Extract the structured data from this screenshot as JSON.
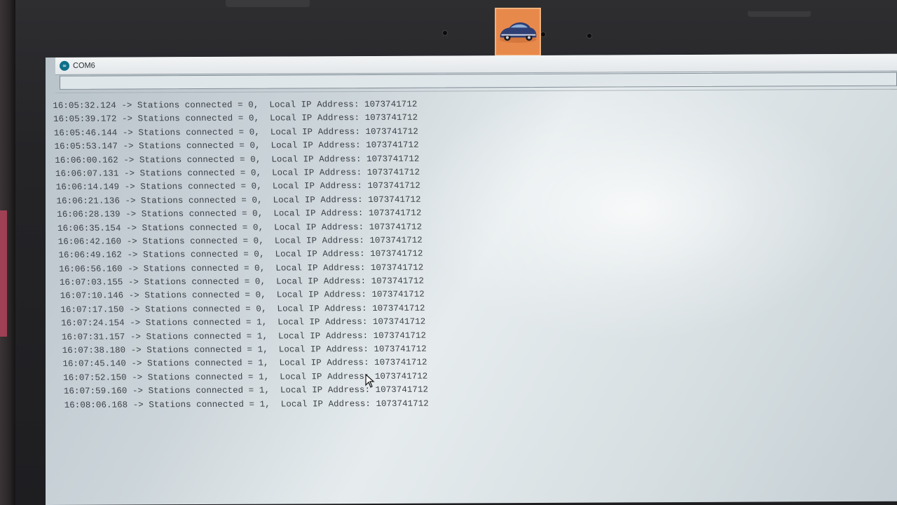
{
  "window": {
    "title": "COM6",
    "app_icon": "arduino-icon",
    "send_field_value": ""
  },
  "serial_output": [
    {
      "time": "16:05:32.124",
      "arrow": "->",
      "label": "Stations connected",
      "eq": "=",
      "count": "0,",
      "ip_label": "Local IP Address:",
      "ip": "1073741712"
    },
    {
      "time": "16:05:39.172",
      "arrow": "->",
      "label": "Stations connected",
      "eq": "=",
      "count": "0,",
      "ip_label": "Local IP Address:",
      "ip": "1073741712"
    },
    {
      "time": "16:05:46.144",
      "arrow": "->",
      "label": "Stations connected",
      "eq": "=",
      "count": "0,",
      "ip_label": "Local IP Address:",
      "ip": "1073741712"
    },
    {
      "time": "16:05:53.147",
      "arrow": "->",
      "label": "Stations connected",
      "eq": "=",
      "count": "0,",
      "ip_label": "Local IP Address:",
      "ip": "1073741712"
    },
    {
      "time": "16:06:00.162",
      "arrow": "->",
      "label": "Stations connected",
      "eq": "=",
      "count": "0,",
      "ip_label": "Local IP Address:",
      "ip": "1073741712"
    },
    {
      "time": "16:06:07.131",
      "arrow": "->",
      "label": "Stations connected",
      "eq": "=",
      "count": "0,",
      "ip_label": "Local IP Address:",
      "ip": "1073741712"
    },
    {
      "time": "16:06:14.149",
      "arrow": "->",
      "label": "Stations connected",
      "eq": "=",
      "count": "0,",
      "ip_label": "Local IP Address:",
      "ip": "1073741712"
    },
    {
      "time": "16:06:21.136",
      "arrow": "->",
      "label": "Stations connected",
      "eq": "=",
      "count": "0,",
      "ip_label": "Local IP Address:",
      "ip": "1073741712"
    },
    {
      "time": "16:06:28.139",
      "arrow": "->",
      "label": "Stations connected",
      "eq": "=",
      "count": "0,",
      "ip_label": "Local IP Address:",
      "ip": "1073741712"
    },
    {
      "time": "16:06:35.154",
      "arrow": "->",
      "label": "Stations connected",
      "eq": "=",
      "count": "0,",
      "ip_label": "Local IP Address:",
      "ip": "1073741712"
    },
    {
      "time": "16:06:42.160",
      "arrow": "->",
      "label": "Stations connected",
      "eq": "=",
      "count": "0,",
      "ip_label": "Local IP Address:",
      "ip": "1073741712"
    },
    {
      "time": "16:06:49.162",
      "arrow": "->",
      "label": "Stations connected",
      "eq": "=",
      "count": "0,",
      "ip_label": "Local IP Address:",
      "ip": "1073741712"
    },
    {
      "time": "16:06:56.160",
      "arrow": "->",
      "label": "Stations connected",
      "eq": "=",
      "count": "0,",
      "ip_label": "Local IP Address:",
      "ip": "1073741712"
    },
    {
      "time": "16:07:03.155",
      "arrow": "->",
      "label": "Stations connected",
      "eq": "=",
      "count": "0,",
      "ip_label": "Local IP Address:",
      "ip": "1073741712"
    },
    {
      "time": "16:07:10.146",
      "arrow": "->",
      "label": "Stations connected",
      "eq": "=",
      "count": "0,",
      "ip_label": "Local IP Address:",
      "ip": "1073741712"
    },
    {
      "time": "16:07:17.150",
      "arrow": "->",
      "label": "Stations connected",
      "eq": "=",
      "count": "0,",
      "ip_label": "Local IP Address:",
      "ip": "1073741712"
    },
    {
      "time": "16:07:24.154",
      "arrow": "->",
      "label": "Stations connected",
      "eq": "=",
      "count": "1,",
      "ip_label": "Local IP Address:",
      "ip": "1073741712"
    },
    {
      "time": "16:07:31.157",
      "arrow": "->",
      "label": "Stations connected",
      "eq": "=",
      "count": "1,",
      "ip_label": "Local IP Address:",
      "ip": "1073741712"
    },
    {
      "time": "16:07:38.180",
      "arrow": "->",
      "label": "Stations connected",
      "eq": "=",
      "count": "1,",
      "ip_label": "Local IP Address:",
      "ip": "1073741712"
    },
    {
      "time": "16:07:45.140",
      "arrow": "->",
      "label": "Stations connected",
      "eq": "=",
      "count": "1,",
      "ip_label": "Local IP Address:",
      "ip": "1073741712"
    },
    {
      "time": "16:07:52.150",
      "arrow": "->",
      "label": "Stations connected",
      "eq": "=",
      "count": "1,",
      "ip_label": "Local IP Address:",
      "ip": "1073741712"
    },
    {
      "time": "16:07:59.160",
      "arrow": "->",
      "label": "Stations connected",
      "eq": "=",
      "count": "1,",
      "ip_label": "Local IP Address:",
      "ip": "1073741712"
    },
    {
      "time": "16:08:06.168",
      "arrow": "->",
      "label": "Stations connected",
      "eq": "=",
      "count": "1,",
      "ip_label": "Local IP Address:",
      "ip": "1073741712"
    }
  ],
  "colors": {
    "screen_bg": "#d6dde1",
    "text": "#3b4046",
    "bezel": "#242427",
    "sticker": "#e88b4f"
  },
  "icons": {
    "sticker": "car-sticker-icon",
    "cursor": "mouse-cursor-icon"
  }
}
